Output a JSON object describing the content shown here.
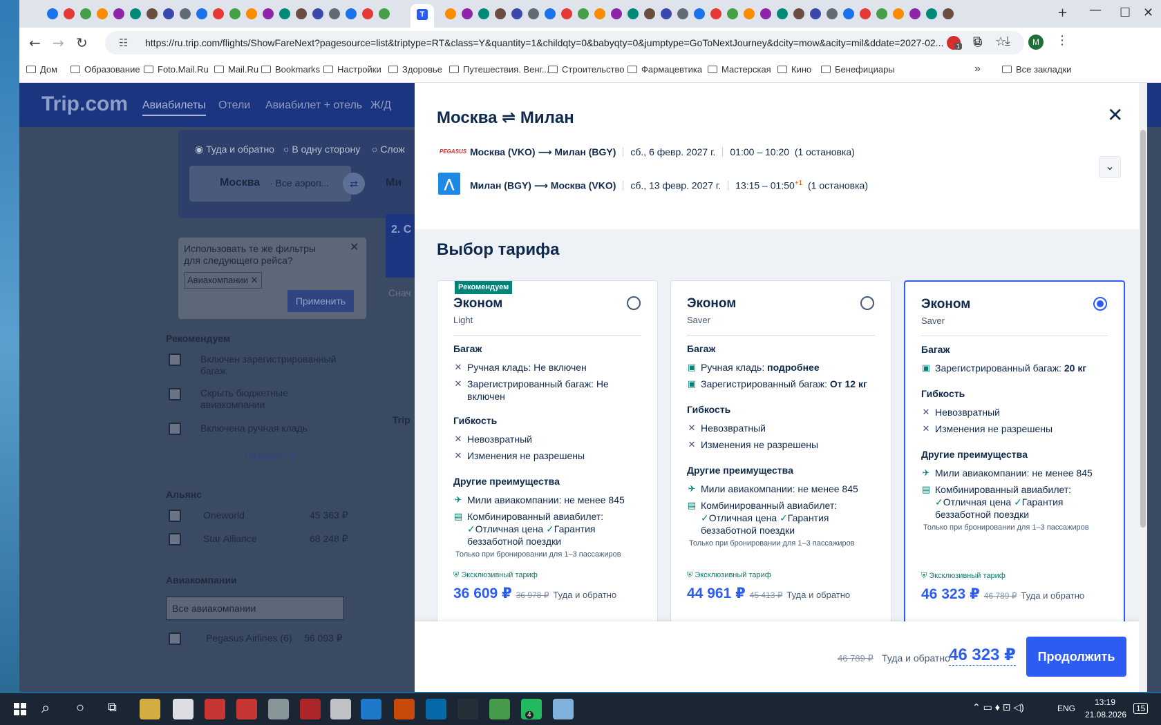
{
  "browser": {
    "url": "https://ru.trip.com/flights/ShowFareNext?pagesource=list&triptype=RT&class=Y&quantity=1&childqty=0&babyqty=0&jumptype=GoToNextJourney&dcity=mow&acity=mil&ddate=2027-02...",
    "active_tab_icon": "T",
    "bookmarks": [
      "Дом",
      "Образование",
      "Foto.Mail.Ru",
      "Mail.Ru",
      "Bookmarks",
      "Настройки",
      "Здоровье",
      "Путешествия. Венг...",
      "Строительство",
      "Фармацевтика",
      "Мастерская",
      "Кино",
      "Бенефициары"
    ],
    "all_bookmarks": "Все закладки",
    "profile_initial": "М",
    "ext_badge": "1"
  },
  "site": {
    "logo": "Trip.com",
    "nav": [
      "Авиабилеты",
      "Отели",
      "Авиабилет + отель",
      "Ж/Д"
    ],
    "trip_type": [
      "Туда и обратно",
      "В одну сторону",
      "Слож"
    ],
    "from_city": "Москва",
    "from_sub": "· Все аэроп...",
    "to_city": "Ми",
    "filter_prompt": "Использовать те же фильтры для следующего рейса?",
    "filter_tag": "Авиакомпании",
    "apply_btn": "Применить",
    "recommended_h": "Рекомендуем",
    "rec_items": [
      "Включен зарегистрированный багаж",
      "Скрыть бюджетные авиакомпании",
      "Включена ручная кладь"
    ],
    "expand": "Развернуть",
    "alliance_h": "Альянс",
    "alliances": [
      {
        "name": "Oneworld",
        "price": "45 363 ₽"
      },
      {
        "name": "Star Alliance",
        "price": "68 248 ₽"
      }
    ],
    "airlines_h": "Авиакомпании",
    "airlines_all": "Все авиакомпании",
    "airline_row": {
      "name": "Pegasus Airlines (6)",
      "price": "56 093 ₽"
    },
    "step_label": "2. С",
    "start_label": "Снач",
    "trip_label": "Trip"
  },
  "modal": {
    "title": "Москва ⇌ Милан",
    "legs": [
      {
        "route": "Москва (VKO) ⟶ Милан (BGY)",
        "date": "сб., 6 февр. 2027 г.",
        "time": "01:00 – 10:20",
        "sup": "",
        "stops": "(1 остановка)",
        "airline": "PEGASUS"
      },
      {
        "route": "Милан (BGY) ⟶ Москва (VKO)",
        "date": "сб., 13 февр. 2027 г.",
        "time": "13:15 – 01:50",
        "sup": "+1",
        "stops": "(1 остановка)",
        "airline": ""
      }
    ],
    "section_title": "Выбор тарифа",
    "fares": [
      {
        "badge": "Рекомендуем",
        "name": "Эконом",
        "sub": "Light",
        "selected": false,
        "baggage_h": "Багаж",
        "baggage": [
          {
            "icon": "x",
            "text": "Ручная кладь: Не включен"
          },
          {
            "icon": "x",
            "text": "Зарегистрированный багаж: Не включен"
          }
        ],
        "flex_h": "Гибкость",
        "flex": [
          {
            "icon": "x",
            "text": "Невозвратный"
          },
          {
            "icon": "x",
            "text": "Изменения не разрешены"
          }
        ],
        "other_h": "Другие преимущества",
        "miles": "Мили авиакомпании: не менее 845",
        "combo": "Комбинированный авиабилет:",
        "combo_good": "Отличная цена",
        "combo_guar": "Гарантия беззаботной поездки",
        "note": "Только при бронировании для 1–3 пассажиров",
        "exclusive": "Эксклюзивный тариф",
        "price": "36 609 ₽",
        "old": "36 978 ₽",
        "dir": "Туда и обратно"
      },
      {
        "badge": "",
        "name": "Эконом",
        "sub": "Saver",
        "selected": false,
        "baggage_h": "Багаж",
        "baggage": [
          {
            "icon": "bag",
            "text": "Ручная кладь: ",
            "bold": "подробнее"
          },
          {
            "icon": "bag",
            "text": "Зарегистрированный багаж: ",
            "bold": "От 12 кг"
          }
        ],
        "flex_h": "Гибкость",
        "flex": [
          {
            "icon": "x",
            "text": "Невозвратный"
          },
          {
            "icon": "x",
            "text": "Изменения не разрешены"
          }
        ],
        "other_h": "Другие преимущества",
        "miles": "Мили авиакомпании: не менее 845",
        "combo": "Комбинированный авиабилет:",
        "combo_good": "Отличная цена",
        "combo_guar": "Гарантия беззаботной поездки",
        "note": "Только при бронировании для 1–3 пассажиров",
        "exclusive": "Эксклюзивный тариф",
        "price": "44 961 ₽",
        "old": "45 413 ₽",
        "dir": "Туда и обратно"
      },
      {
        "badge": "",
        "name": "Эконом",
        "sub": "Saver",
        "selected": true,
        "baggage_h": "Багаж",
        "baggage": [
          {
            "icon": "bag",
            "text": "Зарегистрированный багаж: ",
            "bold": "20 кг"
          }
        ],
        "flex_h": "Гибкость",
        "flex": [
          {
            "icon": "x",
            "text": "Невозвратный"
          },
          {
            "icon": "x",
            "text": "Изменения не разрешены"
          }
        ],
        "other_h": "Другие преимущества",
        "miles": "Мили авиакомпании: не менее 845",
        "combo": "Комбинированный авиабилет:",
        "combo_good": "Отличная цена",
        "combo_guar": "Гарантия беззаботной поездки",
        "note": "Только при бронировании для 1–3 пассажиров",
        "exclusive": "Эксклюзивный тариф",
        "price": "46 323 ₽",
        "old": "46 789 ₽",
        "dir": "Туда и обратно"
      }
    ],
    "footer": {
      "old": "46 789 ₽",
      "dir": "Туда и обратно",
      "price": "46 323 ₽",
      "continue": "Продолжить"
    }
  },
  "taskbar": {
    "lang": "ENG",
    "time": "13:19",
    "date": "21.08.2026",
    "notif": "15",
    "badge": "4"
  },
  "colors": {
    "accent": "#2d5cf2",
    "text": "#0f294d",
    "badge": "#00847a"
  }
}
